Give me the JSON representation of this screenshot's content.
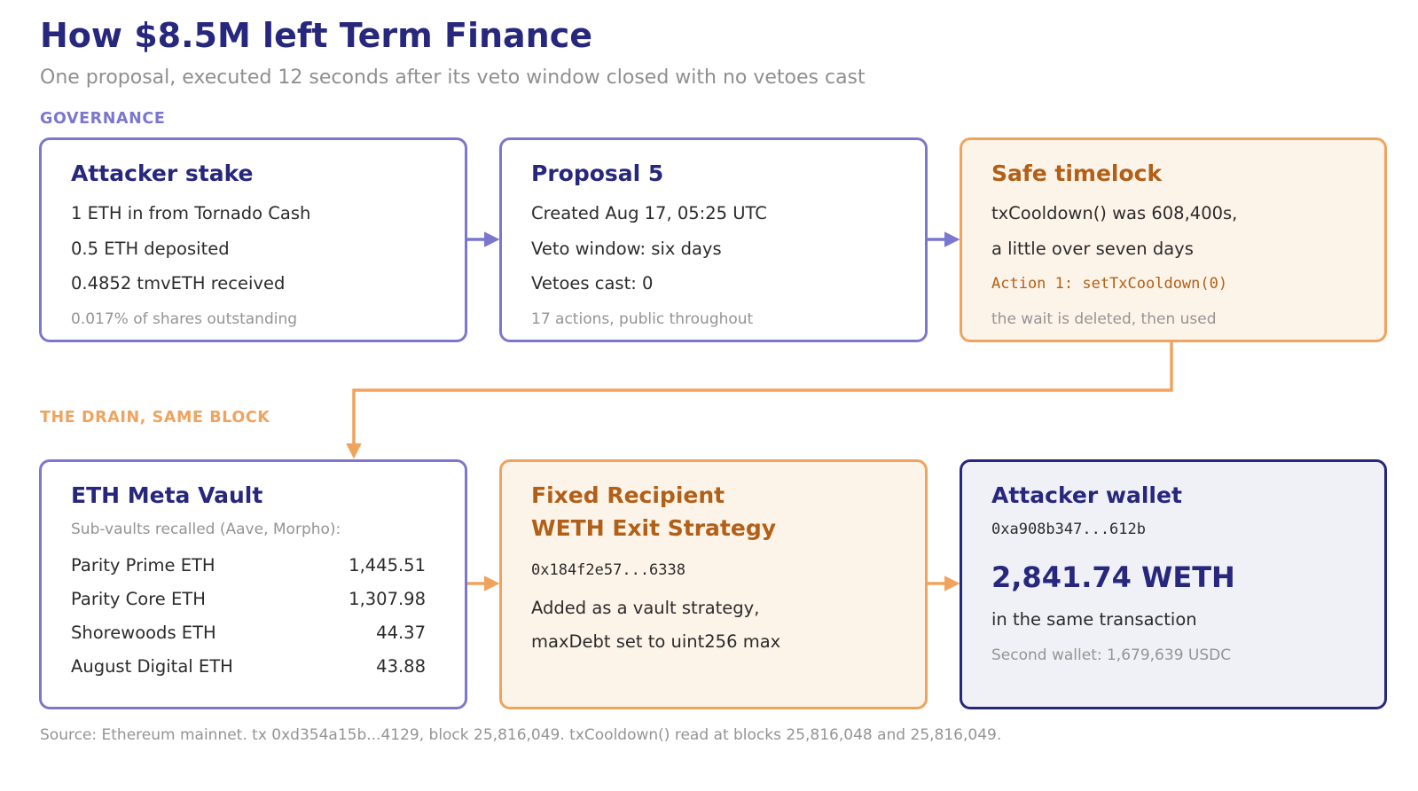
{
  "header": {
    "title": "How $8.5M left Term Finance",
    "subtitle": "One proposal, executed 12 seconds after its veto window closed with no vetoes cast"
  },
  "sections": {
    "governance": "GOVERNANCE",
    "drain": "THE DRAIN, SAME BLOCK"
  },
  "governance": {
    "attacker_stake": {
      "title": "Attacker stake",
      "lines": [
        "1 ETH in from Tornado Cash",
        "0.5 ETH deposited",
        "0.4852 tmvETH received"
      ],
      "note": "0.017% of shares outstanding"
    },
    "proposal": {
      "title": "Proposal 5",
      "lines": [
        "Created Aug 17, 05:25 UTC",
        "Veto window: six days",
        "Vetoes cast: 0"
      ],
      "note": "17 actions, public throughout"
    },
    "timelock": {
      "title": "Safe timelock",
      "lines": [
        "txCooldown() was 608,400s,",
        "a little over seven days"
      ],
      "action": "Action 1: setTxCooldown(0)",
      "note": "the wait is deleted, then used"
    }
  },
  "drain": {
    "vault": {
      "title": "ETH Meta Vault",
      "subtitle": "Sub-vaults recalled (Aave, Morpho):",
      "rows": [
        {
          "name": "Parity Prime ETH",
          "value": "1,445.51"
        },
        {
          "name": "Parity Core ETH",
          "value": "1,307.98"
        },
        {
          "name": "Shorewoods ETH",
          "value": "44.37"
        },
        {
          "name": "August Digital ETH",
          "value": "43.88"
        }
      ]
    },
    "recipient": {
      "title_line1": "Fixed Recipient",
      "title_line2": "WETH Exit Strategy",
      "address": "0x184f2e57...6338",
      "lines": [
        "Added as a vault strategy,",
        "maxDebt set to uint256 max"
      ]
    },
    "wallet": {
      "title": "Attacker wallet",
      "address": "0xa908b347...612b",
      "amount": "2,841.74 WETH",
      "line": "in the same transaction",
      "note": "Second wallet: 1,679,639 USDC"
    }
  },
  "footer": {
    "source": "Source: Ethereum mainnet. tx 0xd354a15b...4129, block 25,816,049. txCooldown() read at blocks 25,816,048 and 25,816,049."
  },
  "colors": {
    "navy": "#27277e",
    "purple": "#7b77ce",
    "orange": "#f0a35d",
    "orange_text": "#b25f17",
    "muted": "#949494"
  }
}
